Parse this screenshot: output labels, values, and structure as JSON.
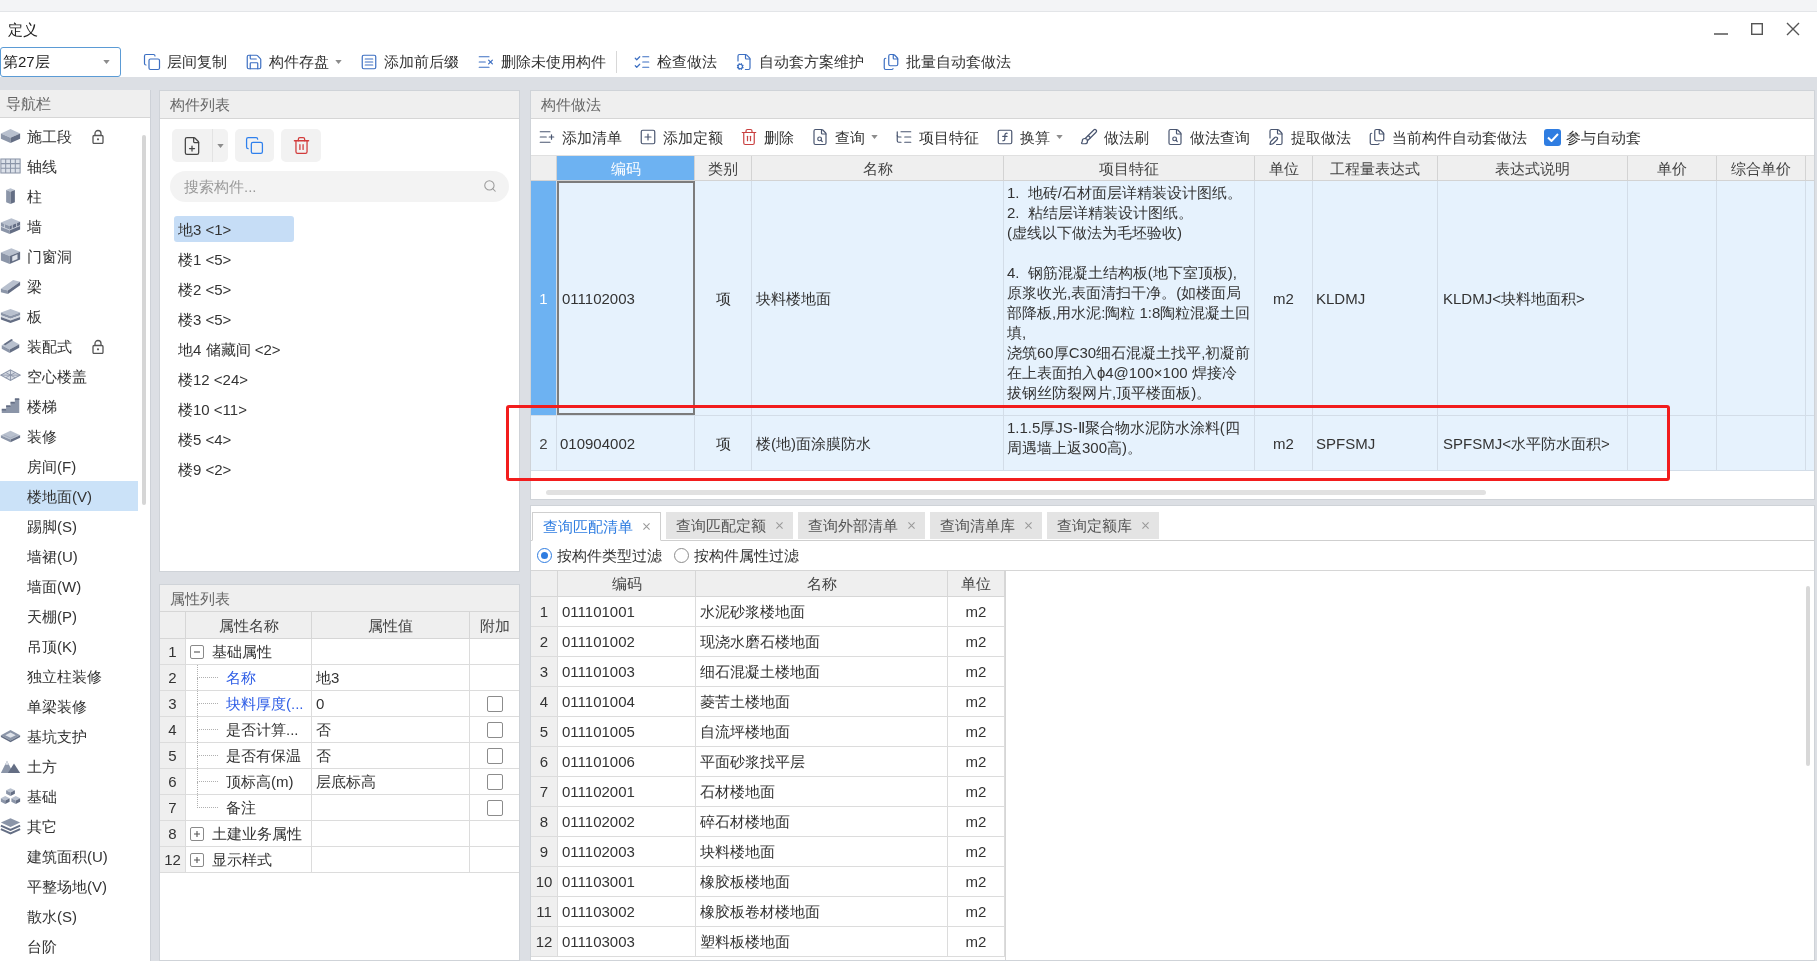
{
  "window": {
    "title": "定义"
  },
  "toolbar": {
    "floor": "第27层",
    "groups": [
      {
        "buttons": [
          {
            "label": "层间复制",
            "dropdown": false
          },
          {
            "label": "构件存盘",
            "dropdown": true
          },
          {
            "label": "添加前后缀",
            "dropdown": false
          },
          {
            "label": "删除未使用构件",
            "dropdown": false
          }
        ]
      },
      {
        "buttons": [
          {
            "label": "检查做法",
            "dropdown": false
          },
          {
            "label": "自动套方案维护",
            "dropdown": false
          },
          {
            "label": "批量自动套做法",
            "dropdown": false
          }
        ]
      }
    ]
  },
  "nav": {
    "title": "导航栏",
    "items": [
      {
        "label": "施工段",
        "locked": true,
        "selected": false
      },
      {
        "label": "轴线",
        "locked": false,
        "selected": false
      },
      {
        "label": "柱",
        "locked": false,
        "selected": false
      },
      {
        "label": "墙",
        "locked": false,
        "selected": false
      },
      {
        "label": "门窗洞",
        "locked": false,
        "selected": false
      },
      {
        "label": "梁",
        "locked": false,
        "selected": false
      },
      {
        "label": "板",
        "locked": false,
        "selected": false
      },
      {
        "label": "装配式",
        "locked": true,
        "selected": false
      },
      {
        "label": "空心楼盖",
        "locked": false,
        "selected": false
      },
      {
        "label": "楼梯",
        "locked": false,
        "selected": false
      },
      {
        "label": "装修",
        "locked": false,
        "selected": false,
        "children": [
          {
            "label": "房间(F)",
            "selected": false
          },
          {
            "label": "楼地面(V)",
            "selected": true
          },
          {
            "label": "踢脚(S)",
            "selected": false
          },
          {
            "label": "墙裙(U)",
            "selected": false
          },
          {
            "label": "墙面(W)",
            "selected": false
          },
          {
            "label": "天棚(P)",
            "selected": false
          },
          {
            "label": "吊顶(K)",
            "selected": false
          },
          {
            "label": "独立柱装修",
            "selected": false
          },
          {
            "label": "单梁装修",
            "selected": false
          }
        ]
      },
      {
        "label": "基坑支护",
        "locked": false,
        "selected": false
      },
      {
        "label": "土方",
        "locked": false,
        "selected": false
      },
      {
        "label": "基础",
        "locked": false,
        "selected": false
      },
      {
        "label": "其它",
        "locked": false,
        "selected": false,
        "children": [
          {
            "label": "建筑面积(U)",
            "selected": false
          },
          {
            "label": "平整场地(V)",
            "selected": false
          },
          {
            "label": "散水(S)",
            "selected": false
          },
          {
            "label": "台阶",
            "selected": false
          }
        ]
      }
    ]
  },
  "component_list": {
    "title": "构件列表",
    "search": {
      "placeholder": "搜索构件..."
    },
    "items": [
      {
        "label": "地3 <1>",
        "selected": true
      },
      {
        "label": "楼1 <5>",
        "selected": false
      },
      {
        "label": "楼2 <5>",
        "selected": false
      },
      {
        "label": "楼3 <5>",
        "selected": false
      },
      {
        "label": "地4 储藏间 <2>",
        "selected": false
      },
      {
        "label": "楼12 <24>",
        "selected": false
      },
      {
        "label": "楼10 <11>",
        "selected": false
      },
      {
        "label": "楼5 <4>",
        "selected": false
      },
      {
        "label": "楼9 <2>",
        "selected": false
      }
    ]
  },
  "properties": {
    "title": "属性列表",
    "columns": [
      "属性名称",
      "属性值",
      "附加"
    ],
    "rows": [
      {
        "num": "1",
        "name": "基础属性",
        "expanded": true,
        "children": [
          {
            "num": "2",
            "name": "名称",
            "value": "地3",
            "emphasized": true
          },
          {
            "num": "3",
            "name": "块料厚度(...",
            "value": "0",
            "emphasized": true,
            "attached": false
          },
          {
            "num": "4",
            "name": "是否计算...",
            "value": "否",
            "emphasized": false,
            "attached": false
          },
          {
            "num": "5",
            "name": "是否有保温",
            "value": "否",
            "emphasized": false,
            "attached": false
          },
          {
            "num": "6",
            "name": "顶标高(m)",
            "value": "层底标高",
            "emphasized": false,
            "attached": false
          },
          {
            "num": "7",
            "name": "备注",
            "emphasized": false,
            "attached": false
          }
        ]
      },
      {
        "num": "8",
        "name": "土建业务属性",
        "expanded": false
      },
      {
        "num": "12",
        "name": "显示样式",
        "expanded": false
      }
    ]
  },
  "method": {
    "title": "构件做法",
    "toolbar": [
      {
        "label": "添加清单",
        "dropdown": false
      },
      {
        "label": "添加定额",
        "dropdown": false
      },
      {
        "label": "删除",
        "dropdown": false
      },
      {
        "label": "查询",
        "dropdown": true
      },
      {
        "label": "项目特征",
        "dropdown": false
      },
      {
        "label": "换算",
        "dropdown": true
      },
      {
        "label": "做法刷",
        "dropdown": false
      },
      {
        "label": "做法查询",
        "dropdown": false
      },
      {
        "label": "提取做法",
        "dropdown": false
      },
      {
        "label": "当前构件自动套做法",
        "dropdown": false
      }
    ],
    "auto_checkbox": {
      "label": "参与自动套",
      "checked": true
    },
    "columns": [
      {
        "label": "编码",
        "selected": true
      },
      {
        "label": "类别",
        "selected": false
      },
      {
        "label": "名称",
        "selected": false
      },
      {
        "label": "项目特征",
        "selected": false
      },
      {
        "label": "单位",
        "selected": false
      },
      {
        "label": "工程量表达式",
        "selected": false
      },
      {
        "label": "表达式说明",
        "selected": false
      },
      {
        "label": "单价",
        "selected": false
      },
      {
        "label": "综合单价",
        "selected": false
      }
    ],
    "rows": [
      {
        "num": "1",
        "selected": true,
        "code": "011102003",
        "category": "项",
        "name": "块料楼地面",
        "features": "1.  地砖/石材面层详精装设计图纸。\n2.  粘结层详精装设计图纸。\n(虚线以下做法为毛坯验收)\n\n4.  钢筋混凝土结构板(地下室顶板),原浆收光,表面清扫干净。(如楼面局部降板,用水泥:陶粒 1:8陶粒混凝土回填,\n浇筑60厚C30细石混凝土找平,初凝前在上表面拍入ɸ4@100×100 焊接冷拔钢丝防裂网片,顶平楼面板)。",
        "unit": "m2",
        "expression": "KLDMJ",
        "expression_note": "KLDMJ<块料地面积>"
      },
      {
        "num": "2",
        "selected": false,
        "code": "010904002",
        "category": "项",
        "name": "楼(地)面涂膜防水",
        "features": "1.1.5厚JS-Ⅱ聚合物水泥防水涂料(四周遇墙上返300高)。",
        "unit": "m2",
        "expression": "SPFSMJ",
        "expression_note": "SPFSMJ<水平防水面积>"
      }
    ]
  },
  "query": {
    "tabs": [
      {
        "label": "查询匹配清单",
        "selected": true
      },
      {
        "label": "查询匹配定额",
        "selected": false
      },
      {
        "label": "查询外部清单",
        "selected": false
      },
      {
        "label": "查询清单库",
        "selected": false
      },
      {
        "label": "查询定额库",
        "selected": false
      }
    ],
    "filters": [
      {
        "label": "按构件类型过滤",
        "selected": true
      },
      {
        "label": "按构件属性过滤",
        "selected": false
      }
    ],
    "columns": [
      "编码",
      "名称",
      "单位"
    ],
    "rows": [
      {
        "num": "1",
        "code": "011101001",
        "name": "水泥砂浆楼地面",
        "unit": "m2"
      },
      {
        "num": "2",
        "code": "011101002",
        "name": "现浇水磨石楼地面",
        "unit": "m2"
      },
      {
        "num": "3",
        "code": "011101003",
        "name": "细石混凝土楼地面",
        "unit": "m2"
      },
      {
        "num": "4",
        "code": "011101004",
        "name": "菱苦土楼地面",
        "unit": "m2"
      },
      {
        "num": "5",
        "code": "011101005",
        "name": "自流坪楼地面",
        "unit": "m2"
      },
      {
        "num": "6",
        "code": "011101006",
        "name": "平面砂浆找平层",
        "unit": "m2"
      },
      {
        "num": "7",
        "code": "011102001",
        "name": "石材楼地面",
        "unit": "m2"
      },
      {
        "num": "8",
        "code": "011102002",
        "name": "碎石材楼地面",
        "unit": "m2"
      },
      {
        "num": "9",
        "code": "011102003",
        "name": "块料楼地面",
        "unit": "m2"
      },
      {
        "num": "10",
        "code": "011103001",
        "name": "橡胶板楼地面",
        "unit": "m2"
      },
      {
        "num": "11",
        "code": "011103002",
        "name": "橡胶板卷材楼地面",
        "unit": "m2"
      },
      {
        "num": "12",
        "code": "011103003",
        "name": "塑料板楼地面",
        "unit": "m2"
      }
    ]
  }
}
